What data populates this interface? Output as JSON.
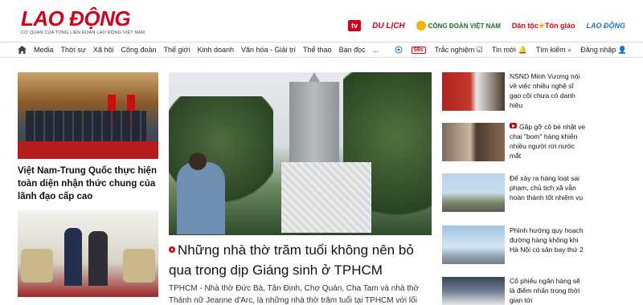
{
  "header": {
    "logo": "LAO ĐỘNG",
    "logo_sub": "CƠ QUAN CỦA TỔNG LIÊN ĐOÀN LAO ĐỘNG VIỆT NAM",
    "brands": [
      "tv",
      "DU LỊCH",
      "CÔNG ĐOÀN VIỆT NAM",
      "Dân tộc",
      "Tôn giáo",
      "LAO ĐỘNG"
    ]
  },
  "nav": {
    "items": [
      "Media",
      "Thời sự",
      "Xã hội",
      "Công đoàn",
      "Thế giới",
      "Kinh doanh",
      "Văn hóa - Giải trí",
      "Thể thao",
      "Bạn đọc",
      "..."
    ],
    "timer": "59s",
    "quiz": "Trắc nghiệm",
    "new": "Tin mới",
    "search": "Tìm kiếm",
    "login": "Đăng nhập"
  },
  "left": {
    "article1": "Việt Nam-Trung Quốc thực hiện toàn diện nhận thức chung của lãnh đạo cấp cao"
  },
  "main": {
    "headline": "Những nhà thờ trăm tuổi không nên bỏ qua trong dịp Giáng sinh ở TPHCM",
    "summary": "TPHCM - Nhà thờ Đức Bà, Tân Định, Chợ Quán, Cha Tam và nhà thờ Thánh nữ Jeanne d'Arc, là những nhà thờ trăm tuổi tại TPHCM với lối kiến..."
  },
  "side": [
    {
      "title": "NSND Minh Vương nói về việc nhiều nghệ sĩ gạo cội chưa có danh hiệu",
      "video": false
    },
    {
      "title": "Gặp gỡ cô bé nhặt ve chai \"bom\" hàng khiến nhiều người rơi nước mắt",
      "video": true
    },
    {
      "title": "Để xảy ra hàng loạt sai phạm, chủ tịch xã vẫn hoàn thành tốt nhiệm vụ",
      "video": false
    },
    {
      "title": "Phình hướng quy hoạch đường hàng không khi Hà Nội có sân bay thứ 2",
      "video": false
    },
    {
      "title": "Cổ phiếu ngân hàng sẽ là điểm nhấn trong thời gian tới",
      "video": false
    }
  ],
  "colors": {
    "brand_red": "#d0021b"
  }
}
